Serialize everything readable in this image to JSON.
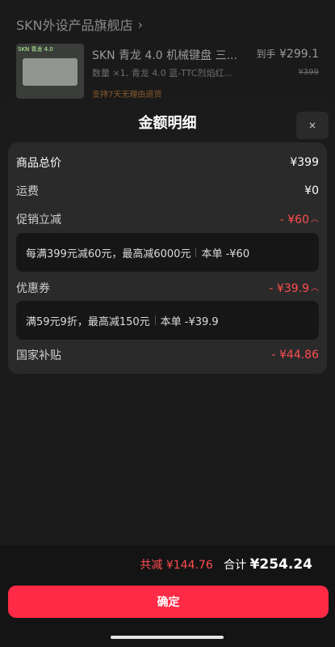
{
  "store": {
    "name": "SKN外设产品旗舰店",
    "chevron": "›"
  },
  "product": {
    "title": "SKN 青龙 4.0 机械键盘 三...",
    "arrive_label": "到手",
    "price": "¥299.1",
    "spec": "数量 ×1, 青龙 4.0 蓝-TTC烈焰红...",
    "original_price": "¥399",
    "return_policy": "支持7天无理由退货",
    "thumb_tag": "SKN 青龙 4.0"
  },
  "modal": {
    "title": "金额明细",
    "close_icon": "×",
    "rows": [
      {
        "label": "商品总价",
        "value": "¥399"
      },
      {
        "label": "运费",
        "value": "¥0"
      },
      {
        "label": "促销立减",
        "value": "- ¥60"
      },
      {
        "label": "优惠券",
        "value": "- ¥39.9"
      },
      {
        "label": "国家补贴",
        "value": "- ¥44.86"
      }
    ],
    "promo_detail": {
      "text": "每满399元减60元，最高减6000元",
      "this_order": "本单 -¥60"
    },
    "coupon_detail": {
      "text": "满59元9折，最高减150元",
      "this_order": "本单 -¥39.9"
    }
  },
  "bottom": {
    "total_discount_label": "共减",
    "total_discount": "¥144.76",
    "sum_label": "合计",
    "sum_value": "¥254.24",
    "confirm_label": "确定"
  },
  "colors": {
    "accent": "#ff2a45",
    "discount": "#ff4d4f"
  }
}
